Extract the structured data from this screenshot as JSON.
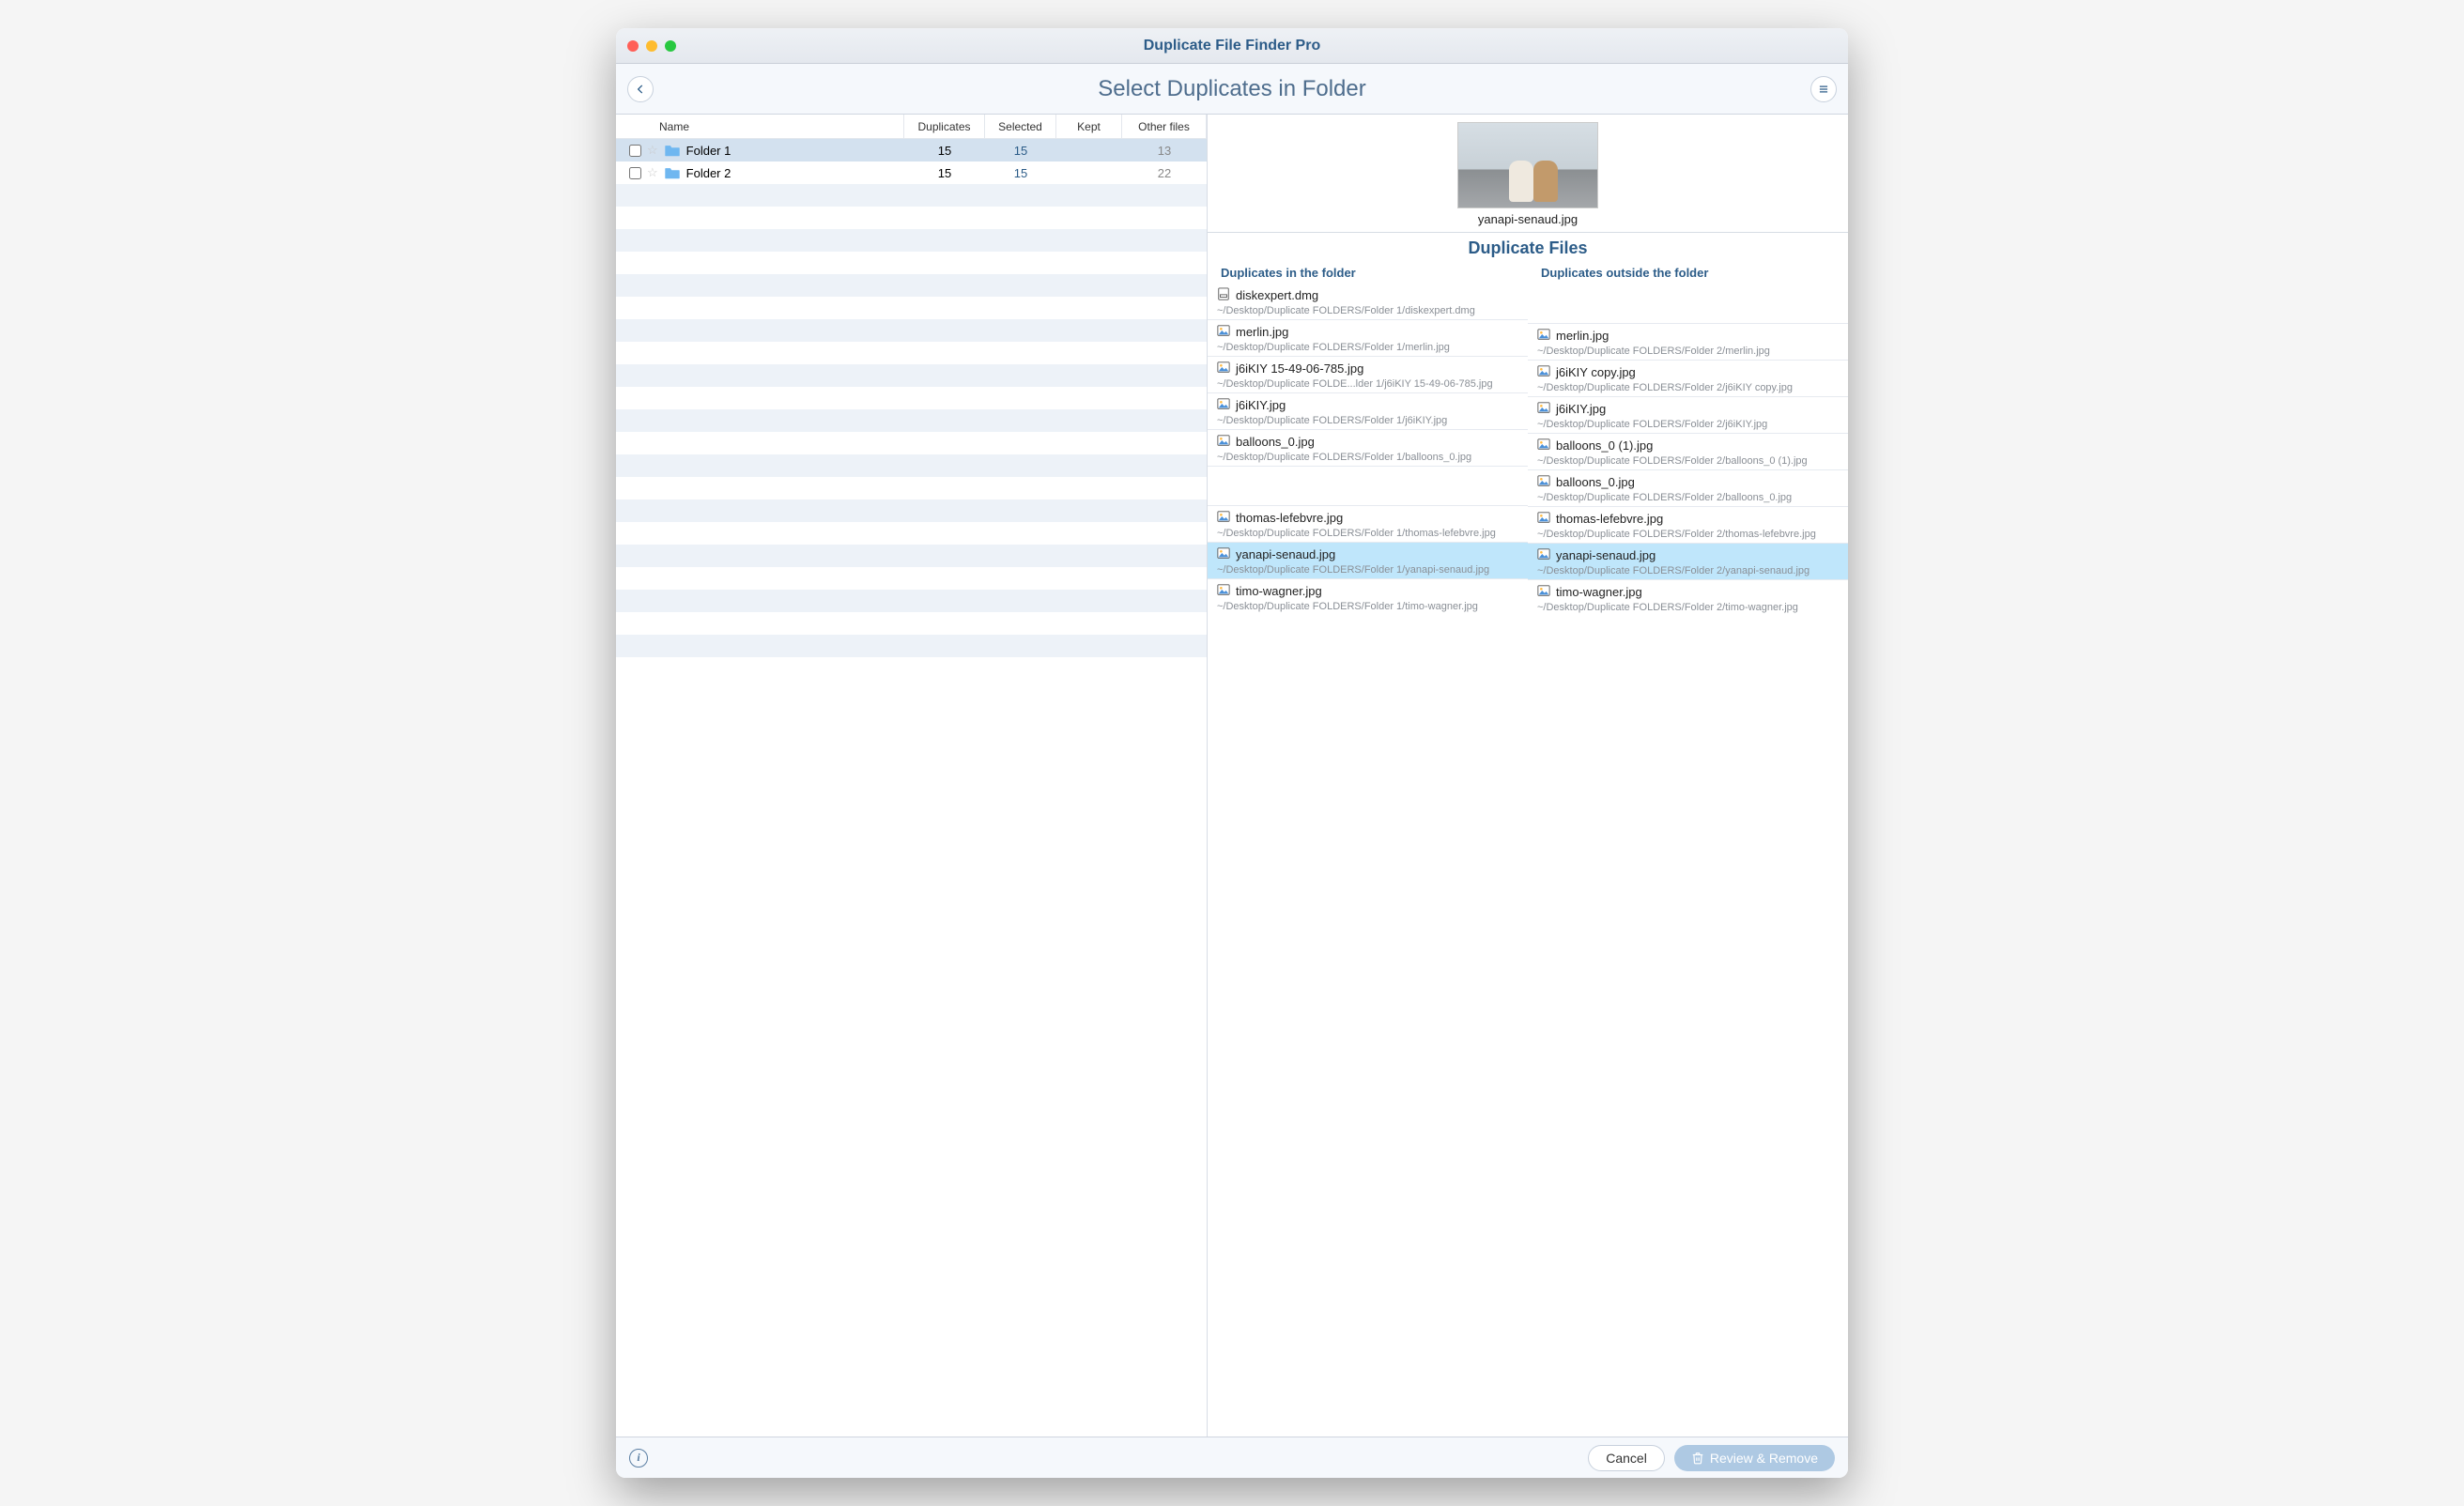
{
  "window": {
    "title": "Duplicate File Finder Pro"
  },
  "toolbar": {
    "title": "Select Duplicates in Folder"
  },
  "columns": {
    "name": "Name",
    "duplicates": "Duplicates",
    "selected": "Selected",
    "kept": "Kept",
    "other": "Other files"
  },
  "folders": [
    {
      "name": "Folder 1",
      "duplicates": "15",
      "selected": "15",
      "kept": "",
      "other": "13",
      "active": true
    },
    {
      "name": "Folder 2",
      "duplicates": "15",
      "selected": "15",
      "kept": "",
      "other": "22",
      "active": false
    }
  ],
  "preview": {
    "filename": "yanapi-senaud.jpg"
  },
  "dup_section_title": "Duplicate Files",
  "dup_columns": {
    "inside": "Duplicates in the folder",
    "outside": "Duplicates outside the folder"
  },
  "rows": [
    {
      "in": {
        "name": "diskexpert.dmg",
        "path": "~/Desktop/Duplicate FOLDERS/Folder 1/diskexpert.dmg",
        "type": "dmg"
      },
      "out": null
    },
    {
      "in": {
        "name": "merlin.jpg",
        "path": "~/Desktop/Duplicate FOLDERS/Folder 1/merlin.jpg",
        "type": "img"
      },
      "out": {
        "name": "merlin.jpg",
        "path": "~/Desktop/Duplicate FOLDERS/Folder 2/merlin.jpg",
        "type": "img"
      }
    },
    {
      "in": {
        "name": "j6iKIY 15-49-06-785.jpg",
        "path": "~/Desktop/Duplicate FOLDE...lder 1/j6iKIY 15-49-06-785.jpg",
        "type": "img"
      },
      "out": {
        "name": "j6iKIY copy.jpg",
        "path": "~/Desktop/Duplicate FOLDERS/Folder 2/j6iKIY copy.jpg",
        "type": "img"
      }
    },
    {
      "in": {
        "name": "j6iKIY.jpg",
        "path": "~/Desktop/Duplicate FOLDERS/Folder 1/j6iKIY.jpg",
        "type": "img"
      },
      "out": {
        "name": "j6iKIY.jpg",
        "path": "~/Desktop/Duplicate FOLDERS/Folder 2/j6iKIY.jpg",
        "type": "img"
      }
    },
    {
      "in": {
        "name": "balloons_0.jpg",
        "path": "~/Desktop/Duplicate FOLDERS/Folder 1/balloons_0.jpg",
        "type": "img"
      },
      "out": {
        "name": "balloons_0 (1).jpg",
        "path": "~/Desktop/Duplicate FOLDERS/Folder 2/balloons_0 (1).jpg",
        "type": "img"
      }
    },
    {
      "in": null,
      "out": {
        "name": "balloons_0.jpg",
        "path": "~/Desktop/Duplicate FOLDERS/Folder 2/balloons_0.jpg",
        "type": "img"
      }
    },
    {
      "in": {
        "name": "thomas-lefebvre.jpg",
        "path": "~/Desktop/Duplicate FOLDERS/Folder 1/thomas-lefebvre.jpg",
        "type": "img"
      },
      "out": {
        "name": "thomas-lefebvre.jpg",
        "path": "~/Desktop/Duplicate FOLDERS/Folder 2/thomas-lefebvre.jpg",
        "type": "img"
      }
    },
    {
      "selected": true,
      "in": {
        "name": "yanapi-senaud.jpg",
        "path": "~/Desktop/Duplicate FOLDERS/Folder 1/yanapi-senaud.jpg",
        "type": "img"
      },
      "out": {
        "name": "yanapi-senaud.jpg",
        "path": "~/Desktop/Duplicate FOLDERS/Folder 2/yanapi-senaud.jpg",
        "type": "img"
      }
    },
    {
      "in": {
        "name": "timo-wagner.jpg",
        "path": "~/Desktop/Duplicate FOLDERS/Folder 1/timo-wagner.jpg",
        "type": "img"
      },
      "out": {
        "name": "timo-wagner.jpg",
        "path": "~/Desktop/Duplicate FOLDERS/Folder 2/timo-wagner.jpg",
        "type": "img"
      }
    }
  ],
  "footer": {
    "cancel": "Cancel",
    "review": "Review & Remove"
  }
}
